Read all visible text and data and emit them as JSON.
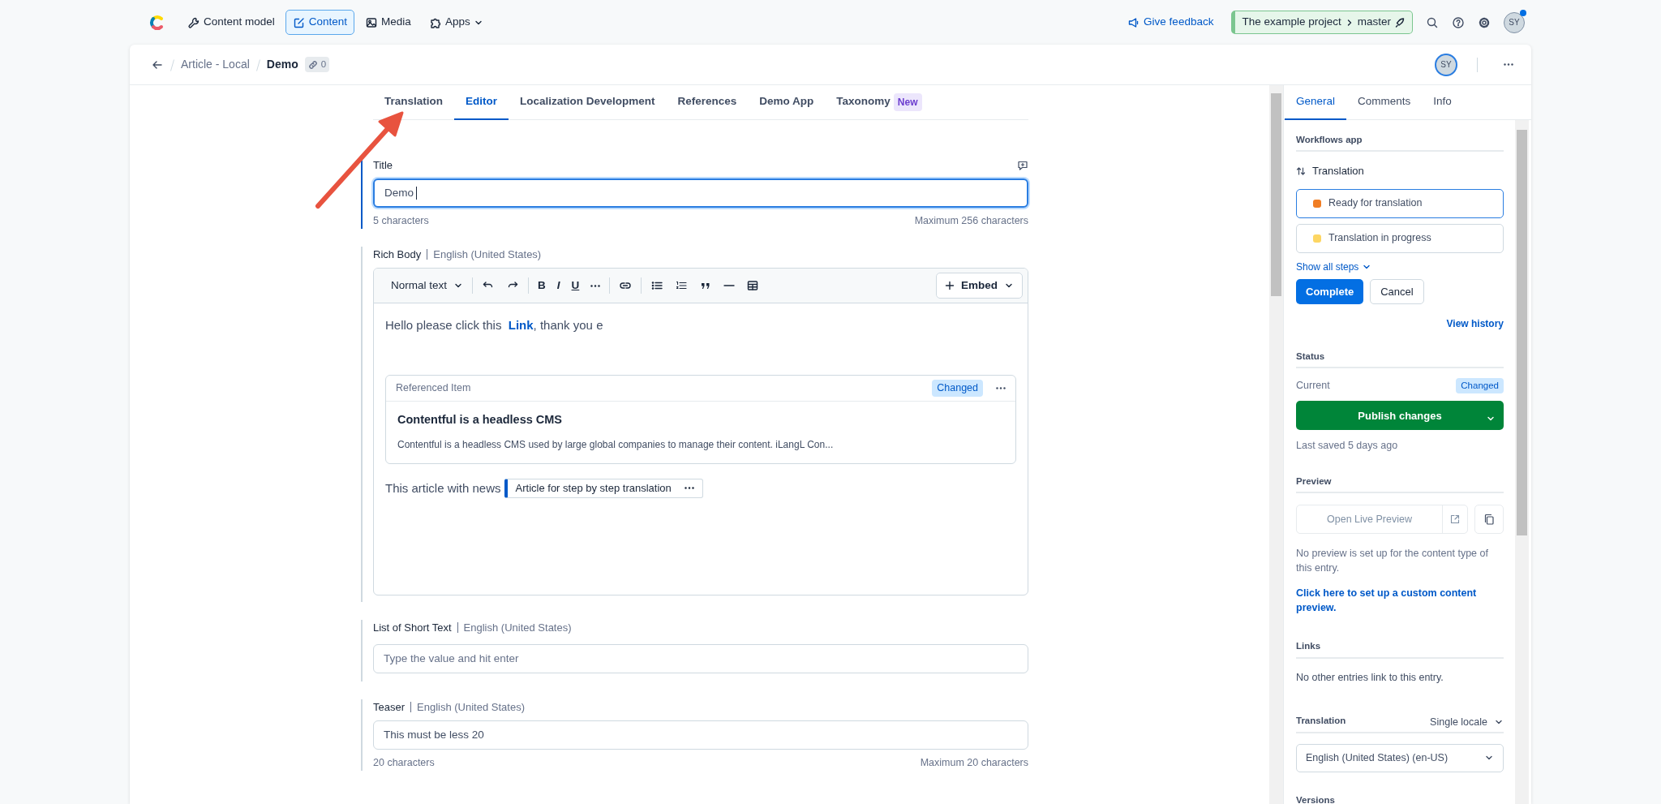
{
  "top_nav": {
    "items": [
      {
        "label": "Content model",
        "selected": false
      },
      {
        "label": "Content",
        "selected": true
      },
      {
        "label": "Media",
        "selected": false
      },
      {
        "label": "Apps",
        "selected": false
      }
    ],
    "feedback": "Give feedback",
    "project": "The example project",
    "environment": "master",
    "avatar": "SY"
  },
  "entry_header": {
    "breadcrumb": "Article - Local",
    "title": "Demo",
    "link_count": "0",
    "avatar": "SY"
  },
  "editor_tabs": [
    {
      "label": "Translation",
      "selected": false
    },
    {
      "label": "Editor",
      "selected": true
    },
    {
      "label": "Localization Development",
      "selected": false
    },
    {
      "label": "References",
      "selected": false
    },
    {
      "label": "Demo App",
      "selected": false
    },
    {
      "label": "Taxonomy",
      "selected": false,
      "badge": "New"
    }
  ],
  "fields": [
    {
      "kind": "text",
      "label": "Title",
      "value": "Demo",
      "focused": true,
      "count": "5 characters",
      "max": "Maximum 256 characters"
    },
    {
      "kind": "rich",
      "label": "Rich Body",
      "locale": "English (United States)",
      "toolbar": {
        "format": "Normal text",
        "marks": [
          "B",
          "I",
          "U"
        ],
        "embed": "Embed"
      },
      "paragraph": {
        "before": "Hello please click this ",
        "link": "Link",
        "after": ", thank you e"
      },
      "reference": {
        "label": "Referenced Item",
        "status": "Changed",
        "title": "Contentful is a headless CMS",
        "description": "Contentful is a headless CMS used by large global companies to manage their content. iLangL Con..."
      },
      "inline": {
        "text": "This article with news",
        "entry": "Article for step by step translation"
      }
    },
    {
      "kind": "list",
      "label": "List of Short Text",
      "locale": "English (United States)",
      "placeholder": "Type the value and hit enter",
      "focused": false
    },
    {
      "kind": "text",
      "label": "Teaser",
      "locale": "English (United States)",
      "value": "This must be less 20",
      "focused": false,
      "count": "20 characters",
      "max": "Maximum 20 characters"
    }
  ],
  "sidebar": {
    "tabs": [
      {
        "label": "General",
        "selected": true
      },
      {
        "label": "Comments",
        "selected": false
      },
      {
        "label": "Info",
        "selected": false
      }
    ],
    "workflow": {
      "section": "Workflows app",
      "name": "Translation",
      "steps": [
        {
          "label": "Ready for translation",
          "color": "#f07d24",
          "selected": true
        },
        {
          "label": "Translation in progress",
          "color": "#fdd663",
          "selected": false
        }
      ],
      "show_all": "Show all steps",
      "complete": "Complete",
      "cancel": "Cancel",
      "history": "View history"
    },
    "status": {
      "section": "Status",
      "current_label": "Current",
      "current": "Changed",
      "publish": "Publish changes",
      "last_saved": "Last saved 5 days ago"
    },
    "preview": {
      "section": "Preview",
      "button": "Open Live Preview",
      "disabled": true,
      "note": "No preview is set up for the content type of this entry.",
      "link": "Click here to set up a custom content preview."
    },
    "links": {
      "section": "Links",
      "note": "No other entries link to this entry."
    },
    "translation": {
      "section": "Translation",
      "mode": "Single locale",
      "locale": "English (United States) (en-US)"
    },
    "versions": {
      "section": "Versions"
    }
  }
}
